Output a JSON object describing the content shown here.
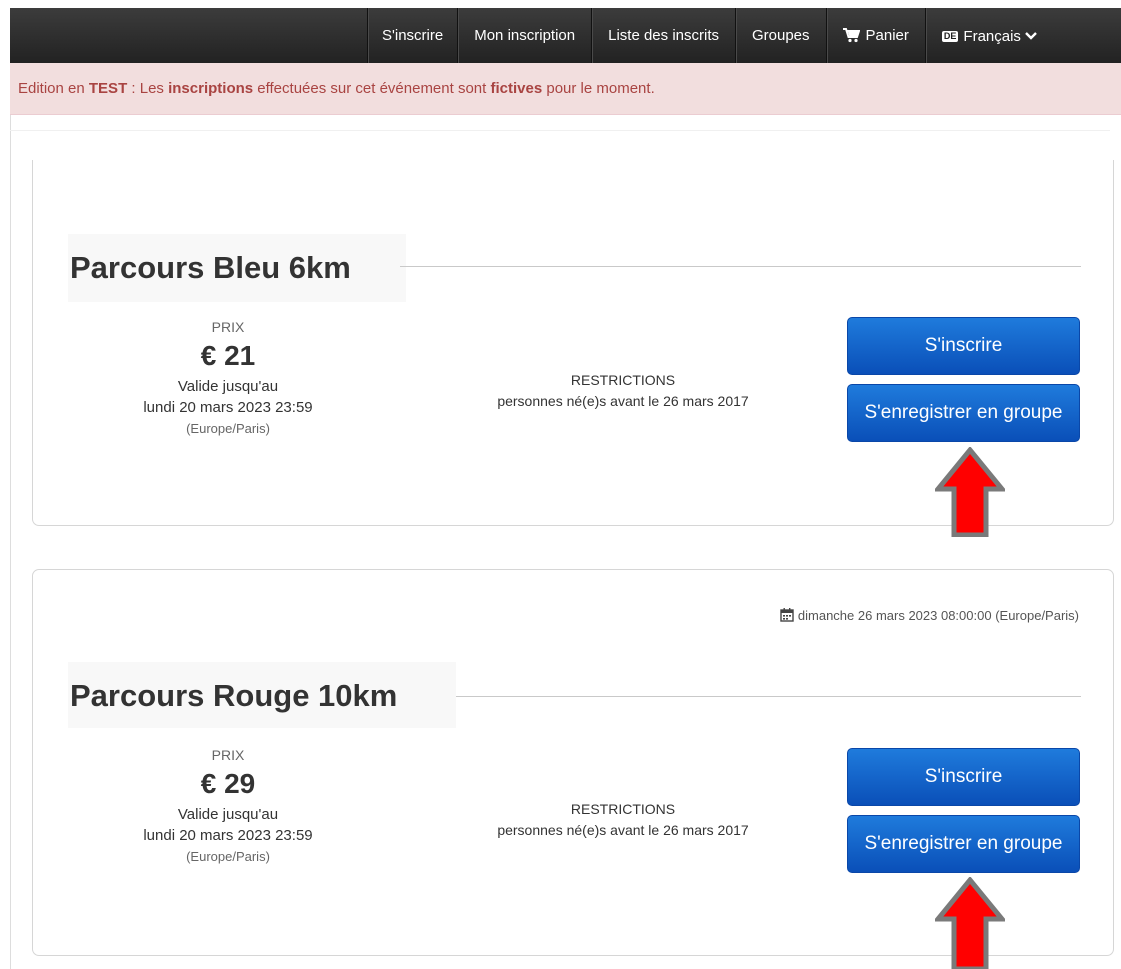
{
  "nav": {
    "items": [
      {
        "label": "S'inscrire"
      },
      {
        "label": "Mon inscription"
      },
      {
        "label": "Liste des inscrits"
      },
      {
        "label": "Groupes"
      },
      {
        "label": "Panier",
        "icon": "shopping-cart-icon"
      },
      {
        "label": "Français",
        "icon": "language-flag-icon",
        "flag_text": "DE"
      }
    ]
  },
  "alert": {
    "part1": "Edition en ",
    "word_test": "TEST",
    "part2": " : Les ",
    "word_inscriptions": "inscriptions",
    "part3": " effectuées sur cet événement sont ",
    "word_fictives": "fictives",
    "part4": " pour le moment.",
    "color": "#a94442",
    "background": "#f2dede"
  },
  "races": [
    {
      "name": "Parcours Bleu 6km",
      "price_label": "PRIX",
      "price": "€ 21",
      "valid_label": "Valide jusqu'au",
      "valid_date": "lundi 20 mars 2023 23:59",
      "timezone": "(Europe/Paris)",
      "restrictions_label": "RESTRICTIONS",
      "restrictions_text": "personnes né(e)s avant le 26 mars 2017",
      "register_label": "S'inscrire",
      "group_label": "S'enregistrer en groupe"
    },
    {
      "name": "Parcours Rouge 10km",
      "date": "dimanche 26 mars 2023 08:00:00 (Europe/Paris)",
      "price_label": "PRIX",
      "price": "€ 29",
      "valid_label": "Valide jusqu'au",
      "valid_date": "lundi 20 mars 2023 23:59",
      "timezone": "(Europe/Paris)",
      "restrictions_label": "RESTRICTIONS",
      "restrictions_text": "personnes né(e)s avant le 26 mars 2017",
      "register_label": "S'inscrire",
      "group_label": "S'enregistrer en groupe"
    }
  ],
  "colors": {
    "button": "#0d5ec7",
    "arrow_fill": "#ff0000",
    "arrow_border": "#7a7a7a"
  }
}
